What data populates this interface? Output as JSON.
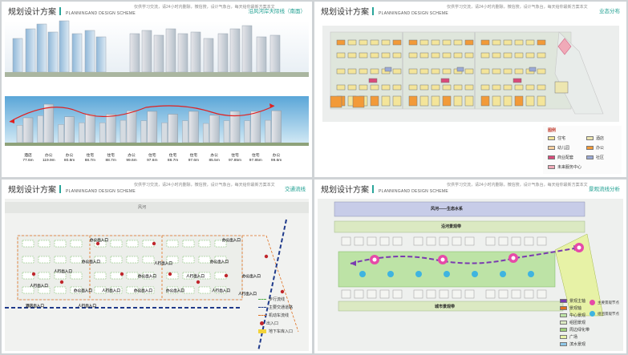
{
  "common": {
    "title": "规划设计方案",
    "title_en": "PLANNINGAND DESIGN SCHEME",
    "note": "仅供学习交流，请24小时内删除，微信搜，设计气象台，每天给你最新方案本文"
  },
  "panel1": {
    "subtitle": "沿风河岸天际线（南面）",
    "buildings": [
      {
        "type": "酒店",
        "height": "77.6m"
      },
      {
        "type": "办公",
        "height": "119.9m"
      },
      {
        "type": "办公",
        "height": "80.8m"
      },
      {
        "type": "住宅",
        "height": "88.7m"
      },
      {
        "type": "住宅",
        "height": "88.7m"
      },
      {
        "type": "办公",
        "height": "99.6m"
      },
      {
        "type": "住宅",
        "height": "97.6m"
      },
      {
        "type": "住宅",
        "height": "88.7m"
      },
      {
        "type": "住宅",
        "height": "97.6m"
      },
      {
        "type": "办公",
        "height": "85.5m"
      },
      {
        "type": "住宅",
        "height": "97.85m"
      },
      {
        "type": "住宅",
        "height": "97.85m"
      },
      {
        "type": "办公",
        "height": "99.6m"
      }
    ]
  },
  "panel2": {
    "subtitle": "业态分布",
    "legend_title": "图例",
    "legend": [
      {
        "label": "住宅",
        "color": "#f4e59a"
      },
      {
        "label": "酒店",
        "color": "#ede6b0"
      },
      {
        "label": "幼儿园",
        "color": "#f8d0a0"
      },
      {
        "label": "办公",
        "color": "#f29a38"
      },
      {
        "label": "商业配套",
        "color": "#d94a7a"
      },
      {
        "label": "社区",
        "color": "#9aa9d6"
      },
      {
        "label": "未来服务中心",
        "color": "#f0aab8"
      }
    ]
  },
  "panel3": {
    "subtitle": "交通流线",
    "road_name": "风河",
    "labels": [
      "办公出入口",
      "办公出入口",
      "办公出入口",
      "人行出入口",
      "办公出入口",
      "办公出入口",
      "人行出入口",
      "办公出入口",
      "人行出入口",
      "人行出入口",
      "办公出入口",
      "人行出入口",
      "办公出入口",
      "办公出入口",
      "人行出入口",
      "人行出入口",
      "酒店出入口",
      "人行出入口"
    ],
    "legend": [
      "步行流线",
      "主要交通道路",
      "机动车流线",
      "出入口",
      "地下车库入口"
    ]
  },
  "panel4": {
    "subtitle": "景观流线分析",
    "band1": "风河——生态水系",
    "band2": "沿河景观带",
    "band3": "城市景观带",
    "legend_left": [
      "景观主轴",
      "景观轴",
      "中心景观",
      "组团景观",
      "周边绿化带",
      "广场",
      "滨水景观"
    ],
    "legend_right": [
      "主要景观节点",
      "组团景观节点"
    ]
  }
}
